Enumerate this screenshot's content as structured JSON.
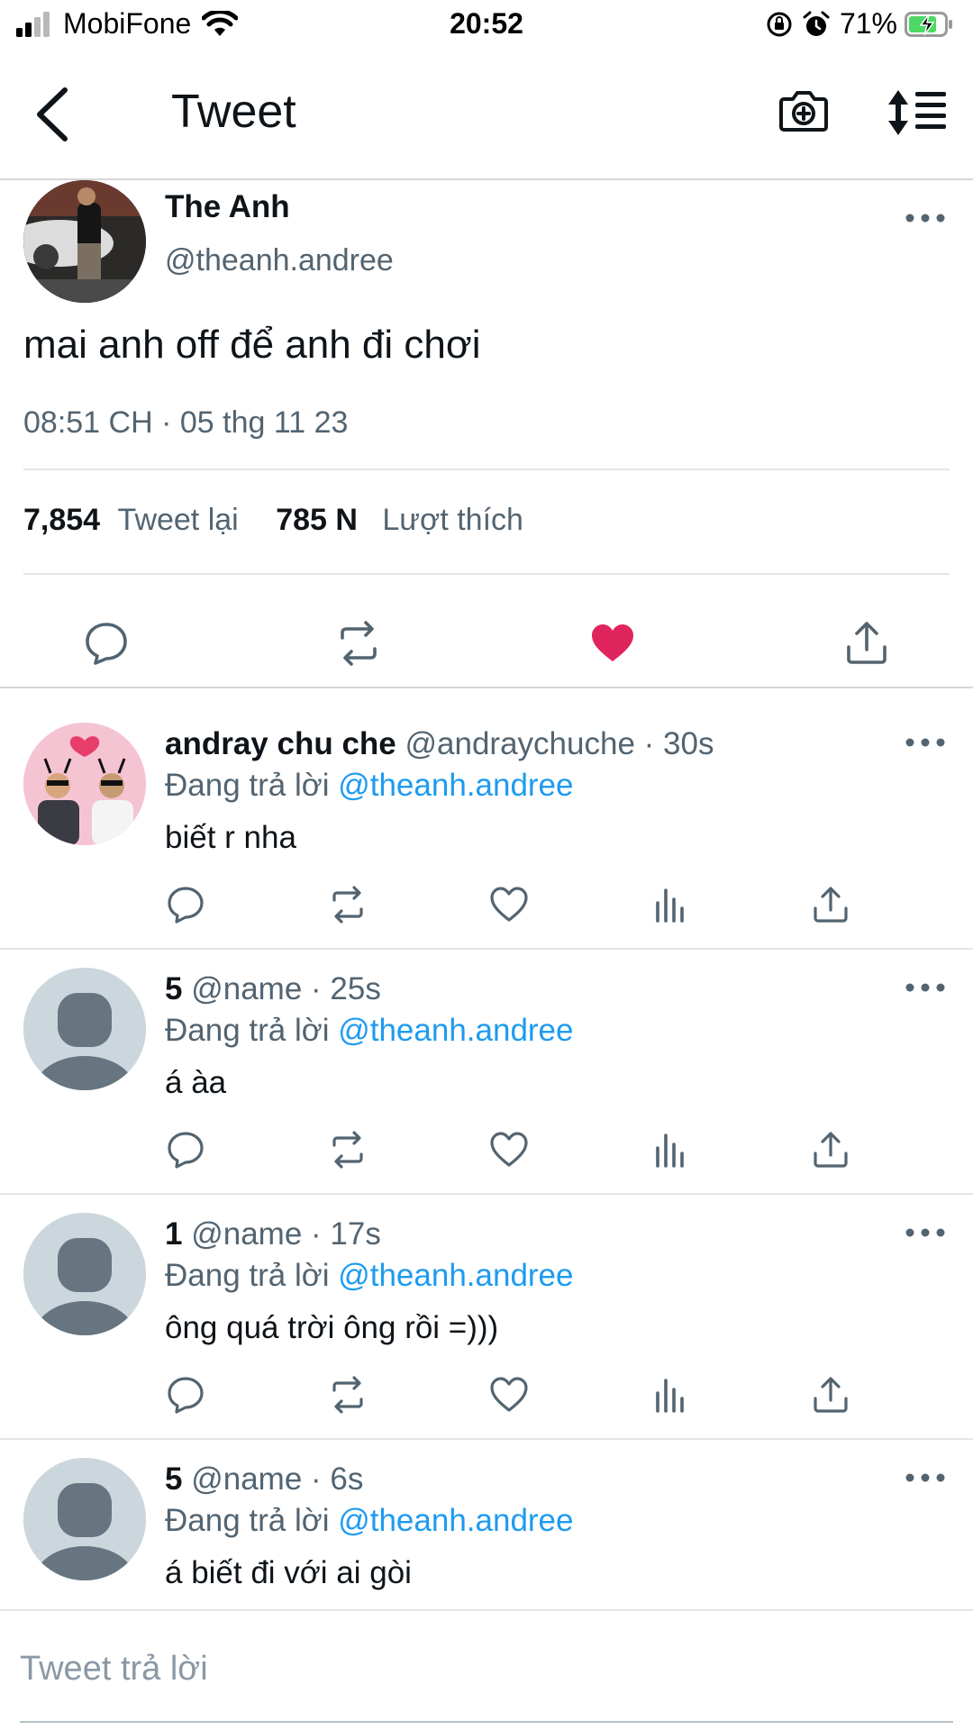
{
  "status_bar": {
    "carrier": "MobiFone",
    "time": "20:52",
    "battery_percent": "71%"
  },
  "nav": {
    "title": "Tweet"
  },
  "main_tweet": {
    "name": "The Anh",
    "handle": "@theanh.andree",
    "text": "mai anh off để anh đi chơi",
    "timestamp": "08:51 CH · 05 thg 11 23",
    "retweets_count": "7,854",
    "retweets_label": "Tweet lại",
    "likes_count": "785 N",
    "likes_label": "Lượt thích",
    "liked": true,
    "like_color": "#e0245e"
  },
  "replies": [
    {
      "name": "andray chu che",
      "handle": "@andraychuche",
      "time": "· 30s",
      "replying_label": "Đang trả lời",
      "replying_to": "@theanh.andree",
      "text": "biết r nha"
    },
    {
      "name": "5",
      "handle": "@name",
      "time": "· 25s",
      "replying_label": "Đang trả lời",
      "replying_to": "@theanh.andree",
      "text": "á àa"
    },
    {
      "name": "1",
      "handle": "@name",
      "time": "· 17s",
      "replying_label": "Đang trả lời",
      "replying_to": "@theanh.andree",
      "text": "ông quá trời ông rồi =)))"
    },
    {
      "name": "5",
      "handle": "@name",
      "time": "· 6s",
      "replying_label": "Đang trả lời",
      "replying_to": "@theanh.andree",
      "text": "á biết đi với ai gòi"
    }
  ],
  "composer": {
    "placeholder": "Tweet trả lời"
  },
  "colors": {
    "accent": "#1d9bf0",
    "like": "#e0245e",
    "secondary_text": "#536471"
  }
}
